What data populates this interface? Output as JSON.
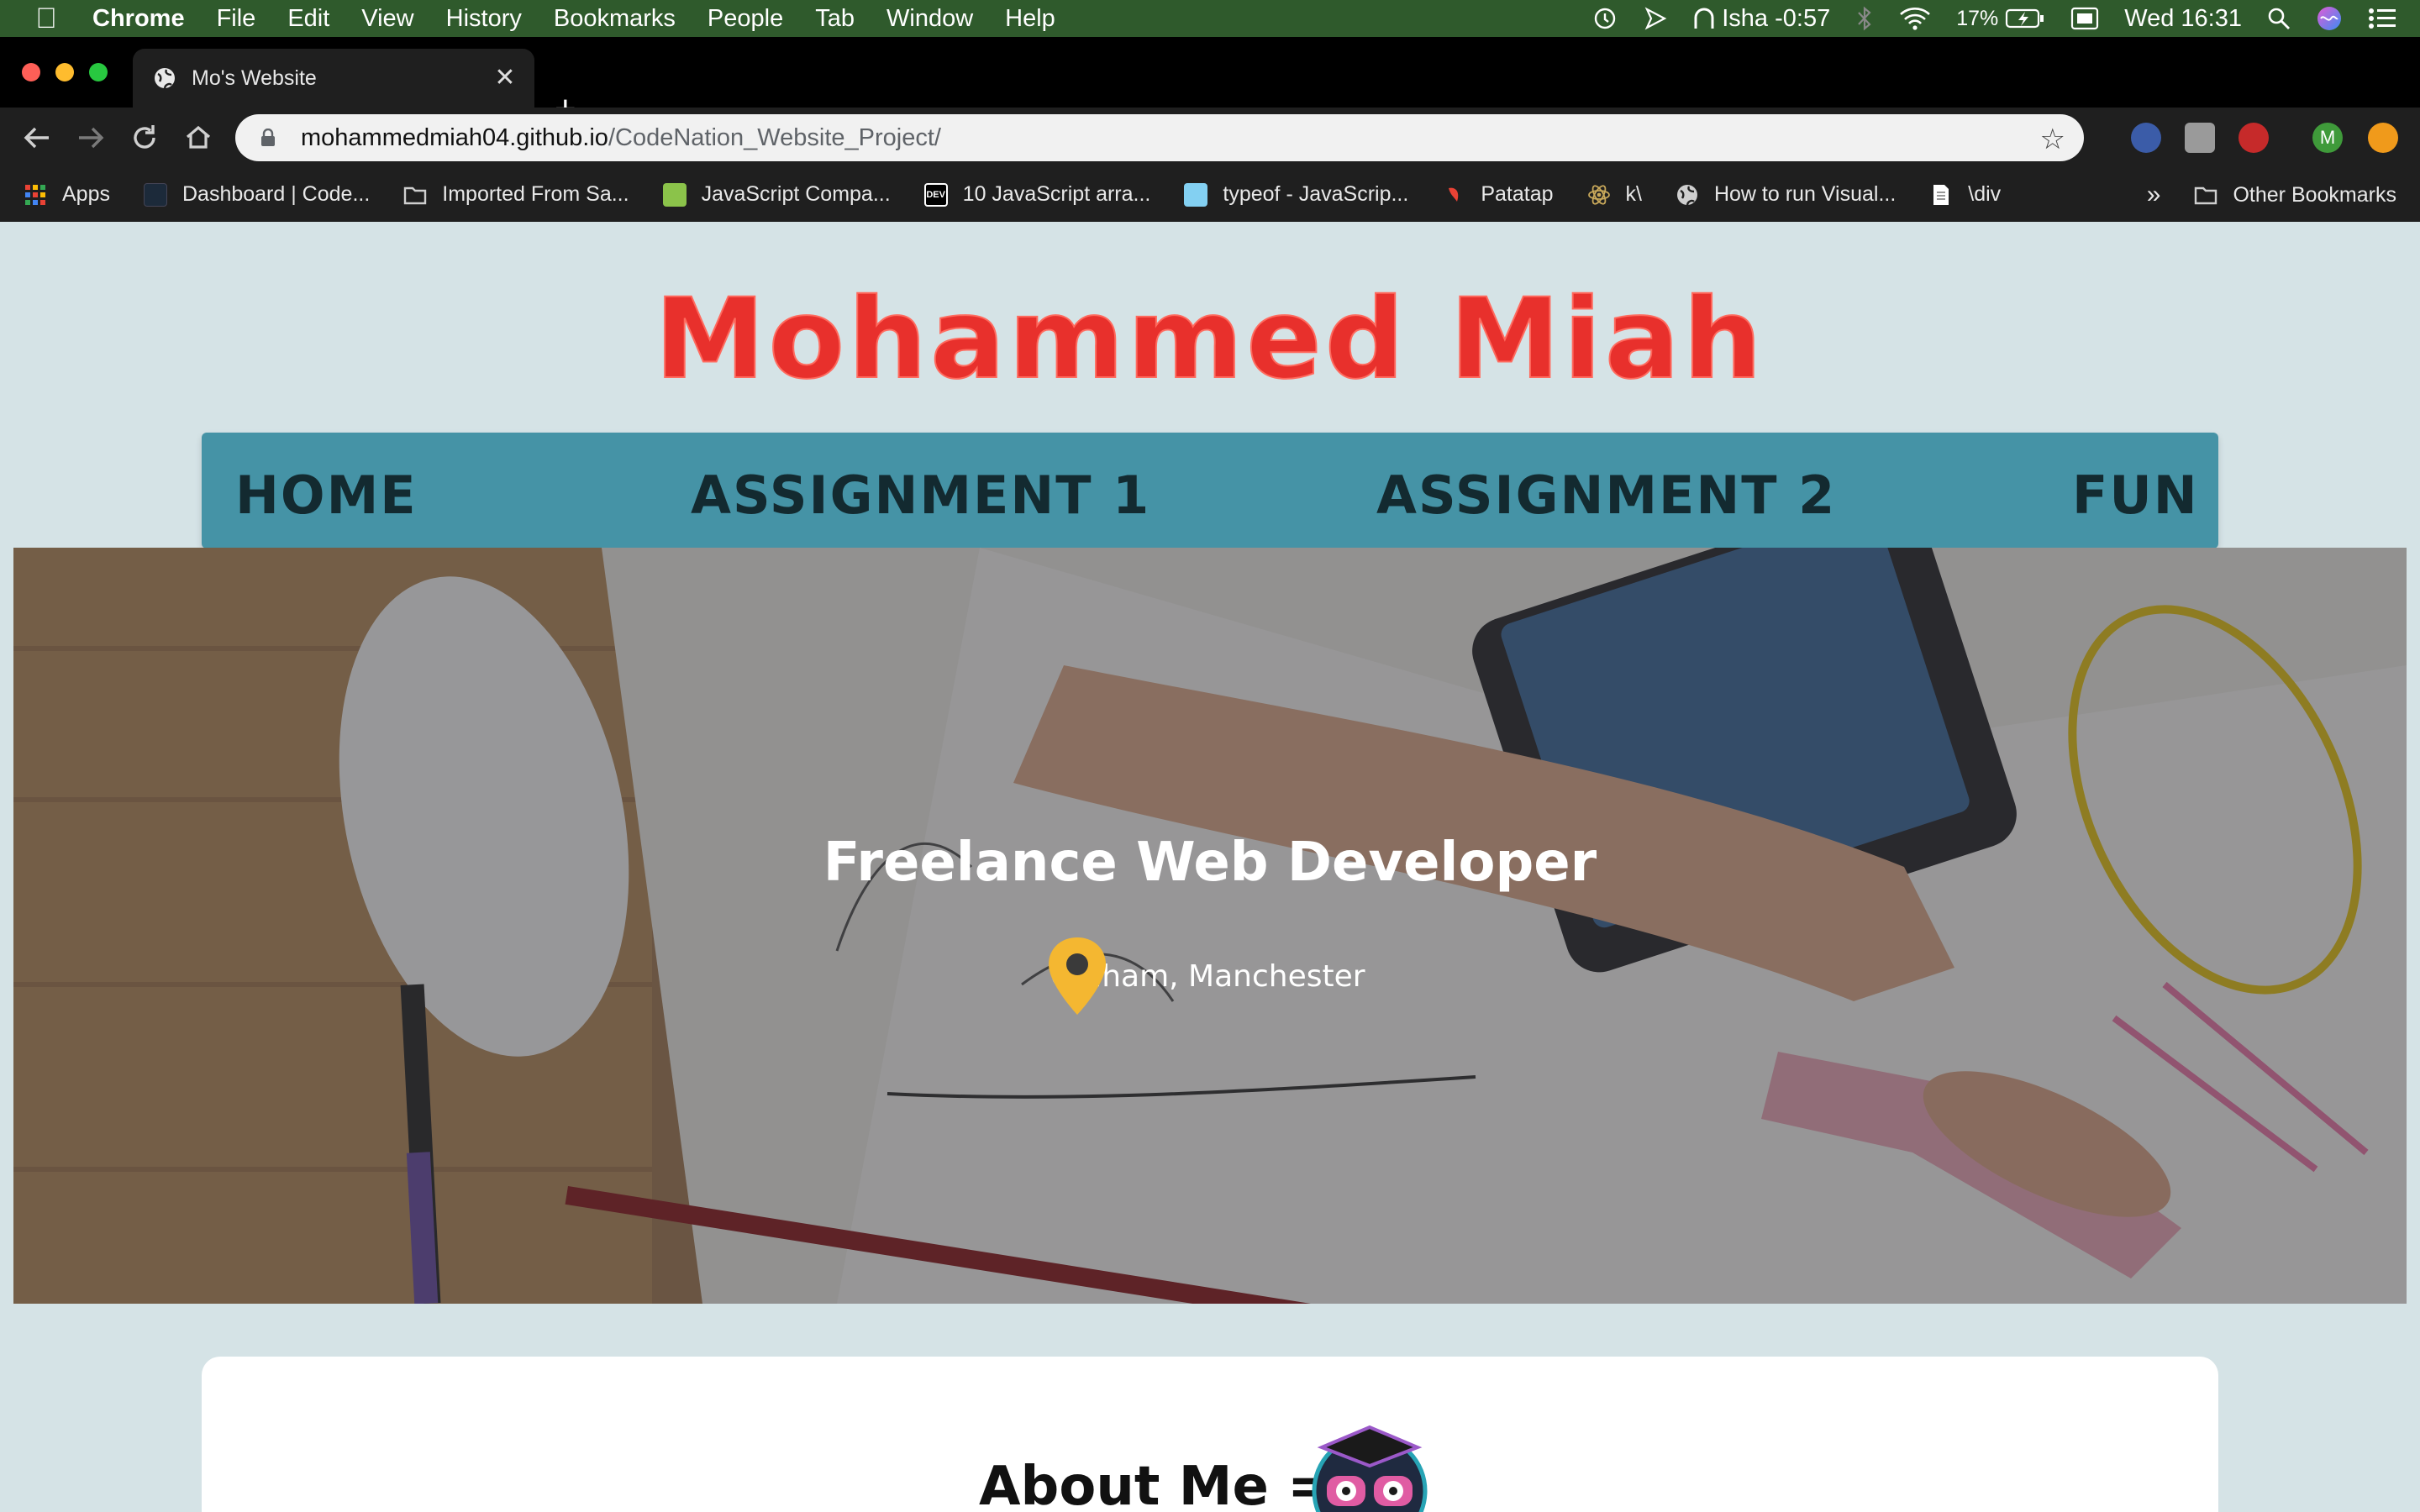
{
  "menubar": {
    "app_name": "Chrome",
    "items": [
      "File",
      "Edit",
      "View",
      "History",
      "Bookmarks",
      "People",
      "Tab",
      "Window",
      "Help"
    ],
    "user": "Isha -0:57",
    "battery": "17%",
    "clock": "Wed 16:31"
  },
  "tab": {
    "title": "Mo's Website",
    "close": "✕",
    "new_tab": "+"
  },
  "omnibox": {
    "host": "mohammedmiah04.github.io",
    "path": "/CodeNation_Website_Project/"
  },
  "bookmarks": {
    "items": [
      {
        "label": "Apps",
        "icon": "apps-grid-icon",
        "color": "#e94235"
      },
      {
        "label": "Dashboard | Code...",
        "icon": "codenation-icon",
        "color": "#1c2a3a"
      },
      {
        "label": "Imported From Sa...",
        "icon": "folder-icon",
        "color": "#cfcfcf"
      },
      {
        "label": "JavaScript Compa...",
        "icon": "w3-icon",
        "color": "#8bc34a"
      },
      {
        "label": "10 JavaScript arra...",
        "icon": "dev-icon",
        "color": "#000000"
      },
      {
        "label": "typeof - JavaScrip...",
        "icon": "mdn-icon",
        "color": "#83d0f2"
      },
      {
        "label": "Patatap",
        "icon": "patatap-icon",
        "color": "#e94235"
      },
      {
        "label": "k\\",
        "icon": "react-icon",
        "color": "#c8a85a"
      },
      {
        "label": "How to run Visual...",
        "icon": "globe-icon",
        "color": "#cfcfcf"
      },
      {
        "label": "\\div",
        "icon": "doc-icon",
        "color": "#ffffff"
      }
    ],
    "overflow": "»",
    "other": "Other Bookmarks"
  },
  "site": {
    "title": "Mohammed Miah",
    "nav": [
      "HOME",
      "ASSIGNMENT 1",
      "ASSIGNMENT 2",
      "FUN"
    ],
    "hero_title": "Freelance Web Developer",
    "location": "Oldham, Manchester",
    "about_title": "About Me ="
  },
  "colors": {
    "title_red": "#e8302c",
    "nav_bg": "#4593a6",
    "nav_text": "#132a30",
    "pin": "#f4b731"
  }
}
